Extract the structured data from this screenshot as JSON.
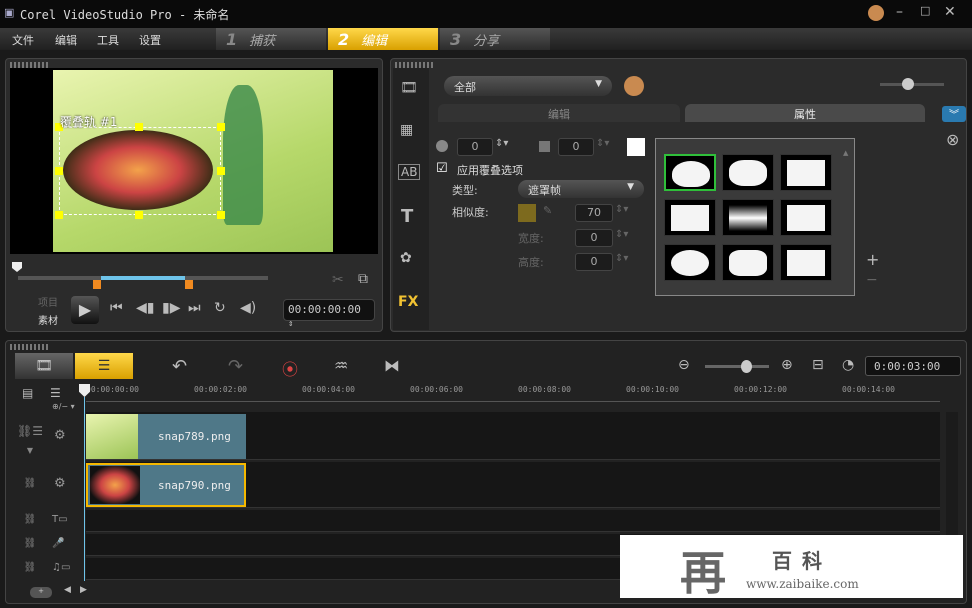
{
  "window": {
    "title": "Corel VideoStudio Pro - 未命名"
  },
  "menu": [
    "文件",
    "编辑",
    "工具",
    "设置"
  ],
  "steps": [
    {
      "num": "1",
      "label": "捕获"
    },
    {
      "num": "2",
      "label": "编辑",
      "active": true
    },
    {
      "num": "3",
      "label": "分享"
    }
  ],
  "preview": {
    "track_label": "覆叠轨 #1",
    "mode_project": "项目",
    "mode_clip": "素材",
    "timecode": "00:00:00:00"
  },
  "library": {
    "category": "全部",
    "tabs": [
      "编辑",
      "属性"
    ],
    "active_tab": "属性"
  },
  "attributes": {
    "opacity": "0",
    "border": "0",
    "apply_overlay_label": "应用覆叠选项",
    "apply_overlay_checked": true,
    "type_label": "类型:",
    "type_value": "遮罩帧",
    "similarity_label": "相似度:",
    "similarity_value": "70",
    "width_label": "宽度:",
    "width_value": "0",
    "height_label": "高度:",
    "height_value": "0",
    "similarity_color": "#7d6a1e",
    "border_color": "#ffffff"
  },
  "timeline": {
    "duration": "0:00:03:00",
    "ticks": [
      "00:00:00:00",
      "00:00:02:00",
      "00:00:04:00",
      "00:00:06:00",
      "00:00:08:00",
      "00:00:10:00",
      "00:00:12:00",
      "00:00:14:00"
    ],
    "clips": [
      {
        "name": "snap789.png",
        "track": "video"
      },
      {
        "name": "snap790.png",
        "track": "overlay"
      }
    ]
  },
  "watermark": {
    "brand": "百科",
    "url": "www.zaibaike.com"
  },
  "colors": {
    "accent": "#f5b800",
    "clip": "#4f7888",
    "selection": "#ffee00"
  }
}
